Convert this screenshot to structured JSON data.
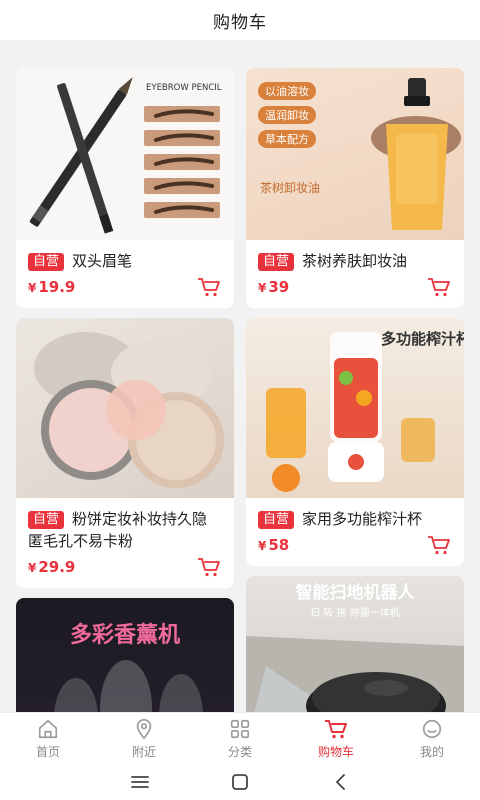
{
  "header": {
    "title": "购物车"
  },
  "products": [
    {
      "badge": "自营",
      "name": "双头眉笔",
      "currency": "¥",
      "price": "19.9",
      "image_text": "EYEBROW PENCIL"
    },
    {
      "badge": "自营",
      "name": "茶树养肤卸妆油",
      "currency": "¥",
      "price": "39",
      "image_tags": [
        "以油溶妆",
        "温润卸妆",
        "草本配方"
      ],
      "image_text": "茶树卸妆油"
    },
    {
      "badge": "自营",
      "name": "粉饼定妆补妆持久隐匿毛孔不易卡粉",
      "currency": "¥",
      "price": "29.9"
    },
    {
      "badge": "自营",
      "name": "家用多功能榨汁杯",
      "currency": "¥",
      "price": "58",
      "image_text": "多功能榨汁杯"
    },
    {
      "image_text": "多彩香薰机"
    },
    {
      "image_text": "智能扫地机器人",
      "image_subtext": "扫 吸 拖 除菌一体机"
    }
  ],
  "tabbar": [
    {
      "label": "首页",
      "icon": "home-icon"
    },
    {
      "label": "附近",
      "icon": "location-icon"
    },
    {
      "label": "分类",
      "icon": "category-icon"
    },
    {
      "label": "购物车",
      "icon": "cart-icon",
      "active": true
    },
    {
      "label": "我的",
      "icon": "profile-icon"
    }
  ],
  "colors": {
    "accent": "#e8323c",
    "inactive": "#888888",
    "background": "#f2f2f2"
  }
}
